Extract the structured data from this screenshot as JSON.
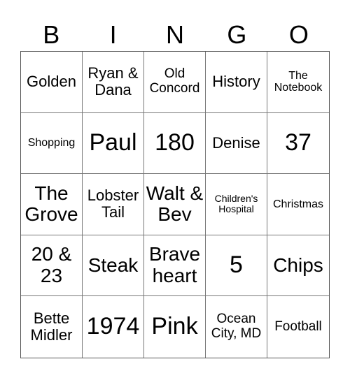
{
  "header": {
    "letters": [
      "B",
      "I",
      "N",
      "G",
      "O"
    ]
  },
  "cells": [
    "Golden",
    "Ryan & Dana",
    "Old Concord",
    "History",
    "The Notebook",
    "Shopping",
    "Paul",
    "180",
    "Denise",
    "37",
    "The Grove",
    "Lobster Tail",
    "Walt & Bev",
    "Children's Hospital",
    "Christmas",
    "20 & 23",
    "Steak",
    "Brave heart",
    "5",
    "Chips",
    "Bette Midler",
    "1974",
    "Pink",
    "Ocean City, MD",
    "Football"
  ]
}
